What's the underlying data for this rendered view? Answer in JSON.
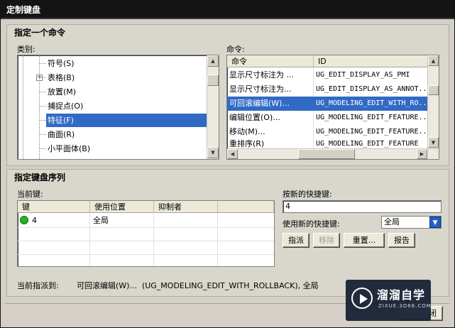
{
  "window": {
    "title": "定制键盘"
  },
  "assign_command": {
    "group_title": "指定一个命令",
    "category_label": "类别:",
    "command_label": "命令:",
    "categories": [
      {
        "label": "符号(S)",
        "selected": false,
        "expandable": false
      },
      {
        "label": "表格(B)",
        "selected": false,
        "expandable": true
      },
      {
        "label": "放置(M)",
        "selected": false,
        "expandable": false
      },
      {
        "label": "捕捉点(O)",
        "selected": false,
        "expandable": false
      },
      {
        "label": "特征(F)",
        "selected": true,
        "expandable": false
      },
      {
        "label": "曲面(R)",
        "selected": false,
        "expandable": false
      },
      {
        "label": "小平面体(B)",
        "selected": false,
        "expandable": false
      }
    ],
    "commands_table": {
      "columns": [
        "命令",
        "ID"
      ],
      "rows": [
        {
          "command": "显示尺寸标注为 ...",
          "id": "UG_EDIT_DISPLAY_AS_PMI",
          "selected": false
        },
        {
          "command": "显示尺寸标注为...",
          "id": "UG_EDIT_DISPLAY_AS_ANNOT...",
          "selected": false
        },
        {
          "command": "可回滚编辑(W)...",
          "id": "UG_MODELING_EDIT_WITH_RO...",
          "selected": true
        },
        {
          "command": "编辑位置(O)...",
          "id": "UG_MODELING_EDIT_FEATURE...",
          "selected": false
        },
        {
          "command": "移动(M)...",
          "id": "UG_MODELING_EDIT_FEATURE...",
          "selected": false
        },
        {
          "command": "重排序(R)",
          "id": "UG_MODELING_EDIT_FEATURE",
          "selected": false
        }
      ]
    }
  },
  "key_sequence": {
    "group_title": "指定键盘序列",
    "current_keys_label": "当前键:",
    "table": {
      "columns": [
        "键",
        "使用位置",
        "抑制者"
      ],
      "rows": [
        {
          "key": "4",
          "location": "全局",
          "suppressed_by": ""
        }
      ]
    },
    "new_shortcut_label": "按新的快捷键:",
    "new_shortcut_value": "4",
    "use_shortcut_label": "使用新的快捷键:",
    "use_shortcut_value": "全局",
    "buttons": {
      "assign": "指派",
      "remove": "移除",
      "reset": "重置...",
      "report": "报告"
    },
    "current_assignment_label": "当前指派到:",
    "current_assignment_value": "可回滚编辑(W)...  (UG_MODELING_EDIT_WITH_ROLLBACK), 全局"
  },
  "footer": {
    "close_partial": "闭"
  },
  "watermark": {
    "brand": "溜溜自学",
    "url": "ZIXUE.3D66.COM"
  },
  "colors": {
    "selection": "#316ac5",
    "titlebar": "#141414",
    "status_dot": "#1fb81f"
  },
  "icons": [
    "expand-plus-icon",
    "scroll-up-icon",
    "scroll-down-icon",
    "scroll-left-icon",
    "scroll-right-icon",
    "dropdown-arrow-icon",
    "status-dot-icon",
    "play-logo-icon"
  ]
}
